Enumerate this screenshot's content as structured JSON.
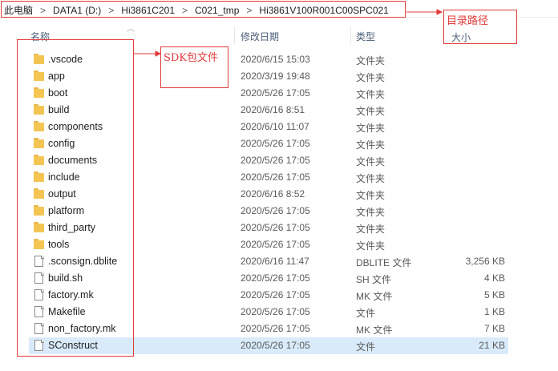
{
  "breadcrumb": {
    "items": [
      "此电脑",
      "DATA1 (D:)",
      "Hi3861C201",
      "C021_tmp",
      "Hi3861V100R001C00SPC021"
    ],
    "separator": ">"
  },
  "columns": {
    "name": "名称",
    "modified": "修改日期",
    "type": "类型",
    "size": "大小"
  },
  "files": [
    {
      "name": ".vscode",
      "modified": "2020/6/15 15:03",
      "type": "文件夹",
      "size": "",
      "kind": "folder"
    },
    {
      "name": "app",
      "modified": "2020/3/19 19:48",
      "type": "文件夹",
      "size": "",
      "kind": "folder"
    },
    {
      "name": "boot",
      "modified": "2020/5/26 17:05",
      "type": "文件夹",
      "size": "",
      "kind": "folder"
    },
    {
      "name": "build",
      "modified": "2020/6/16 8:51",
      "type": "文件夹",
      "size": "",
      "kind": "folder"
    },
    {
      "name": "components",
      "modified": "2020/6/10 11:07",
      "type": "文件夹",
      "size": "",
      "kind": "folder"
    },
    {
      "name": "config",
      "modified": "2020/5/26 17:05",
      "type": "文件夹",
      "size": "",
      "kind": "folder"
    },
    {
      "name": "documents",
      "modified": "2020/5/26 17:05",
      "type": "文件夹",
      "size": "",
      "kind": "folder"
    },
    {
      "name": "include",
      "modified": "2020/5/26 17:05",
      "type": "文件夹",
      "size": "",
      "kind": "folder"
    },
    {
      "name": "output",
      "modified": "2020/6/16 8:52",
      "type": "文件夹",
      "size": "",
      "kind": "folder"
    },
    {
      "name": "platform",
      "modified": "2020/5/26 17:05",
      "type": "文件夹",
      "size": "",
      "kind": "folder"
    },
    {
      "name": "third_party",
      "modified": "2020/5/26 17:05",
      "type": "文件夹",
      "size": "",
      "kind": "folder"
    },
    {
      "name": "tools",
      "modified": "2020/5/26 17:05",
      "type": "文件夹",
      "size": "",
      "kind": "folder"
    },
    {
      "name": ".sconsign.dblite",
      "modified": "2020/6/16 11:47",
      "type": "DBLITE 文件",
      "size": "3,256 KB",
      "kind": "file"
    },
    {
      "name": "build.sh",
      "modified": "2020/5/26 17:05",
      "type": "SH 文件",
      "size": "4 KB",
      "kind": "file"
    },
    {
      "name": "factory.mk",
      "modified": "2020/5/26 17:05",
      "type": "MK 文件",
      "size": "5 KB",
      "kind": "file"
    },
    {
      "name": "Makefile",
      "modified": "2020/5/26 17:05",
      "type": "文件",
      "size": "1 KB",
      "kind": "file"
    },
    {
      "name": "non_factory.mk",
      "modified": "2020/5/26 17:05",
      "type": "MK 文件",
      "size": "7 KB",
      "kind": "file"
    },
    {
      "name": "SConstruct",
      "modified": "2020/5/26 17:05",
      "type": "文件",
      "size": "21 KB",
      "kind": "file",
      "selected": true
    }
  ],
  "annotations": {
    "directory_path": "目录路径",
    "sdk_files": "SDK包文件"
  },
  "colors": {
    "annotation_red": "#e23a3a",
    "folder_yellow": "#f4c553",
    "selection_blue": "#d9ebfb",
    "header_text": "#4c607a"
  }
}
